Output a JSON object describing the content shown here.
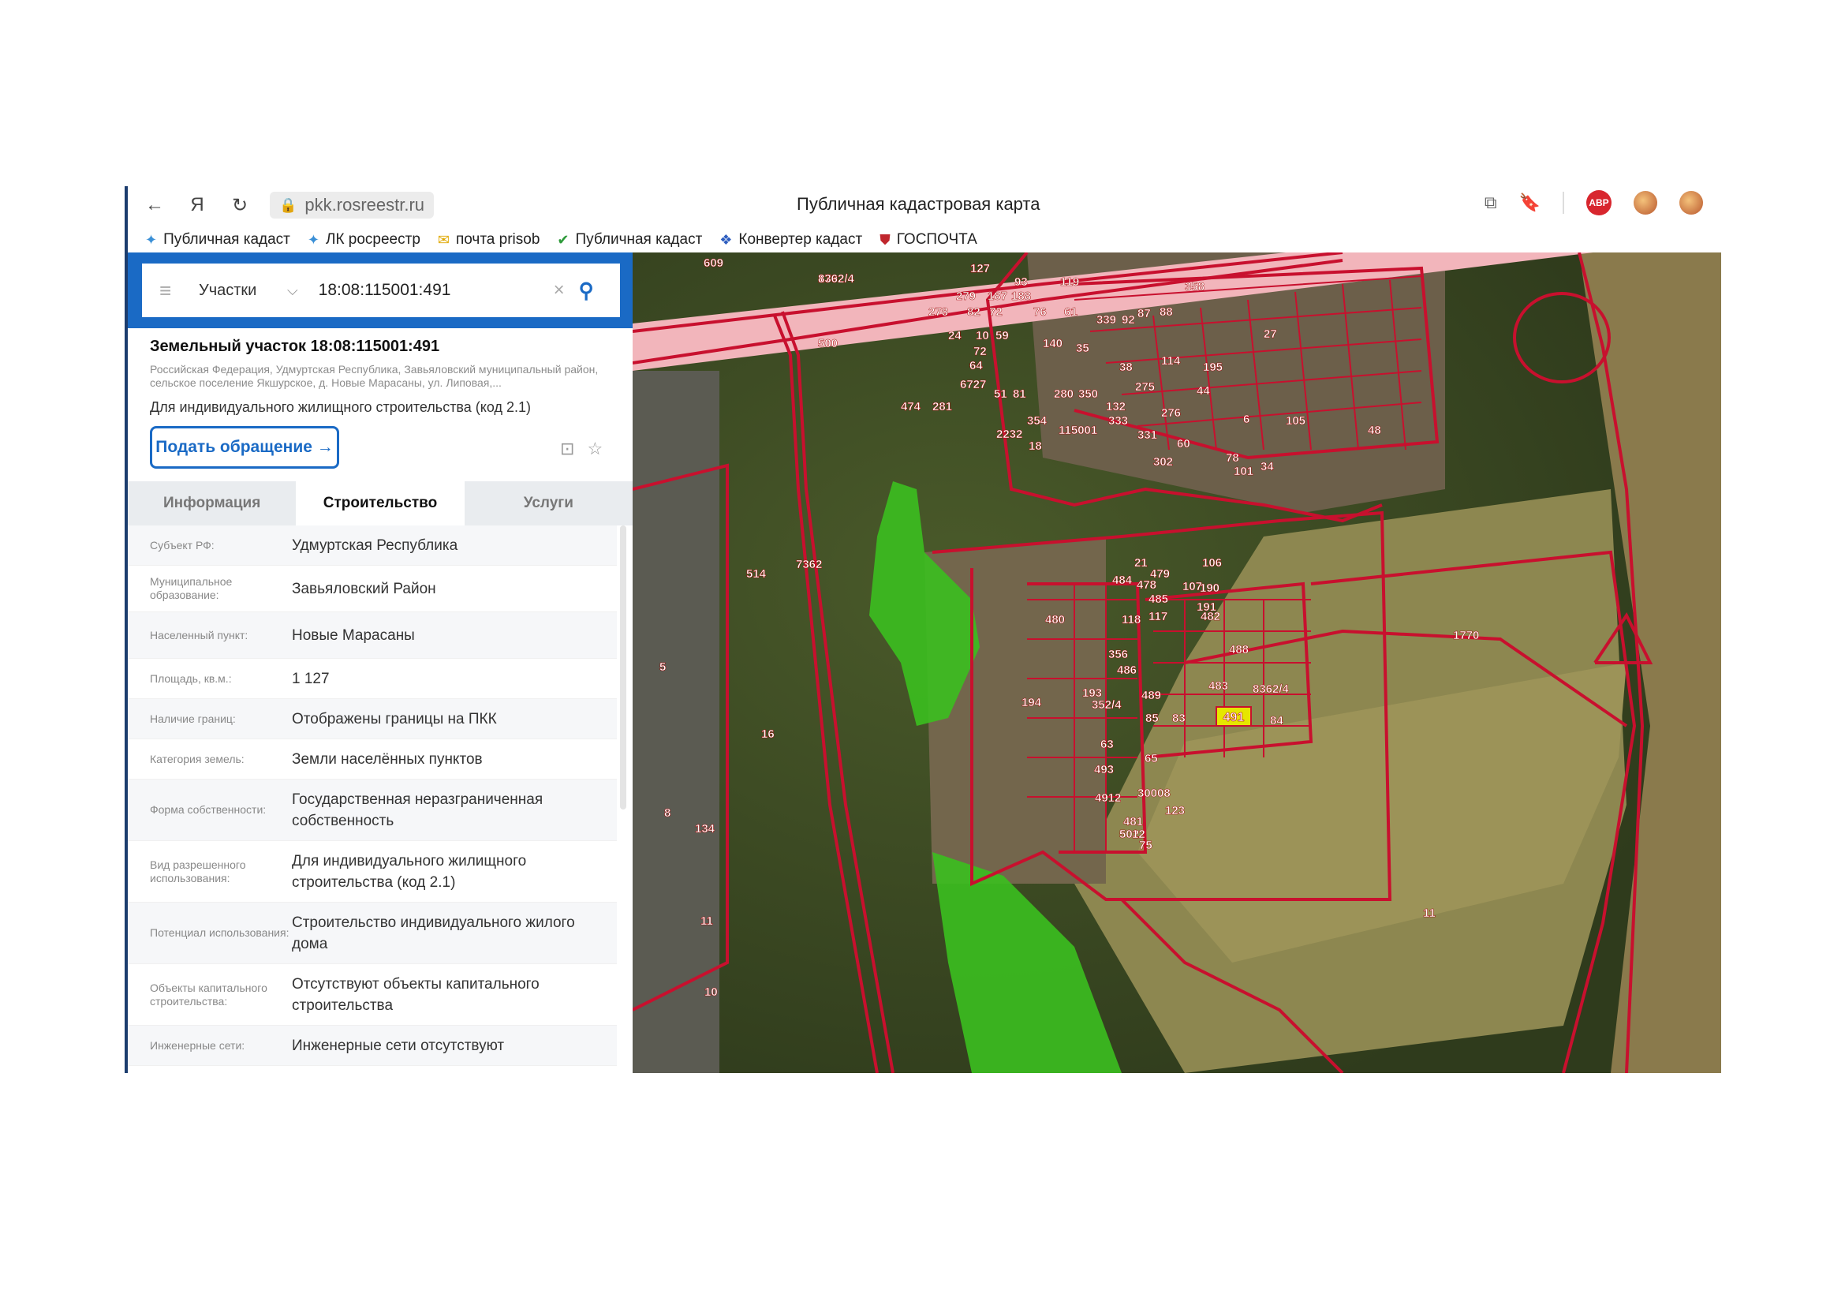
{
  "browser": {
    "url": "pkk.rosreestr.ru",
    "page_title": "Публичная кадастровая карта",
    "adblock_label": "ABP",
    "bookmarks": [
      {
        "label": "Публичная кадаст",
        "icon": "puzzle-icon"
      },
      {
        "label": "ЛК росреестр",
        "icon": "puzzle-icon"
      },
      {
        "label": "почта prisob",
        "icon": "mail-icon"
      },
      {
        "label": "Публичная кадаст",
        "icon": "check-circle-icon"
      },
      {
        "label": "Конвертер кадаст",
        "icon": "grid-icon"
      },
      {
        "label": "ГОСПОЧТА",
        "icon": "shield-icon"
      }
    ]
  },
  "search": {
    "category": "Участки",
    "query": "18:08:115001:491"
  },
  "parcel": {
    "title": "Земельный участок 18:08:115001:491",
    "address": "Российская Федерация, Удмуртская Республика, Завьяловский муниципальный район, сельское поселение Якшурское, д. Новые Марасаны, ул. Липовая,...",
    "purpose": "Для индивидуального жилищного строительства (код 2.1)",
    "request_button": "Подать обращение →"
  },
  "tabs": [
    "Информация",
    "Строительство",
    "Услуги"
  ],
  "active_tab": 1,
  "rows": [
    {
      "label": "Субъект РФ:",
      "value": "Удмуртская Республика"
    },
    {
      "label": "Муниципальное образование:",
      "value": "Завьяловский Район"
    },
    {
      "label": "Населенный пункт:",
      "value": "Новые Марасаны"
    },
    {
      "label": "Площадь, кв.м.:",
      "value": "1 127"
    },
    {
      "label": "Наличие границ:",
      "value": "Отображены границы на ПКК"
    },
    {
      "label": "Категория земель:",
      "value": "Земли населённых пунктов"
    },
    {
      "label": "Форма собственности:",
      "value": "Государственная неразграниченная собственность"
    },
    {
      "label": "Вид разрешенного использования:",
      "value": "Для индивидуального жилищного строительства (код 2.1)"
    },
    {
      "label": "Потенциал использования:",
      "value": "Строительство индивидуального жилого дома"
    },
    {
      "label": "Объекты капитального строительства:",
      "value": "Отсутствуют объекты капитального строительства"
    },
    {
      "label": "Инженерные сети:",
      "value": "Инженерные сети отсутствуют"
    }
  ],
  "map": {
    "highlighted_parcel": "491",
    "labels": [
      "609",
      "179",
      "127",
      "93",
      "119",
      "358",
      "279",
      "187",
      "188",
      "82",
      "278",
      "72",
      "76",
      "61",
      "339",
      "92",
      "87",
      "88",
      "500",
      "24",
      "10",
      "59",
      "27",
      "64",
      "72",
      "140",
      "35",
      "38",
      "114",
      "195",
      "6727",
      "51",
      "81",
      "280",
      "350",
      "275",
      "44",
      "474",
      "281",
      "132",
      "276",
      "6",
      "105",
      "48",
      "2232",
      "354",
      "18",
      "115001",
      "333",
      "331",
      "60",
      "101",
      "34",
      "302",
      "78",
      "514",
      "7362",
      "21",
      "106",
      "478",
      "107",
      "484",
      "479",
      "190",
      "191",
      "485",
      "480",
      "118",
      "117",
      "482",
      "488",
      "1770",
      "356",
      "486",
      "483",
      "8362/4",
      "194",
      "193",
      "352/4",
      "489",
      "85",
      "83",
      "84",
      "16",
      "63",
      "65",
      "493",
      "30008",
      "4912",
      "502",
      "481",
      "12",
      "75",
      "123",
      "8",
      "134",
      "11",
      "10",
      "11",
      "5",
      "6",
      "8362/4",
      "1"
    ],
    "colors": {
      "boundary": "#c8102e",
      "highlight": "#e6e600",
      "forest_zone": "#3bbf1f",
      "road": "#f2b5bb"
    }
  }
}
